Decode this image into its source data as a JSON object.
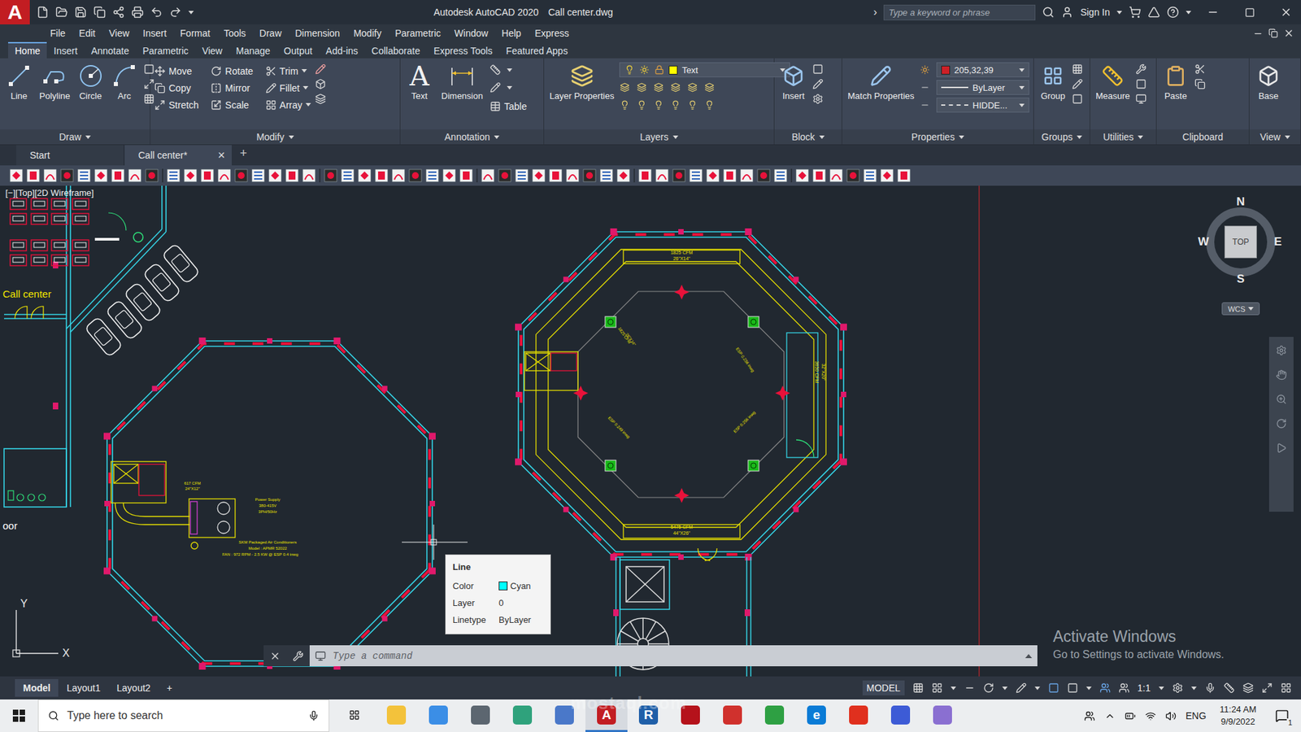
{
  "title_bar": {
    "logo": "A",
    "app": "Autodesk AutoCAD 2020",
    "file": "Call center.dwg",
    "expand": "›",
    "search_placeholder": "Type a keyword or phrase",
    "sign_in": "Sign In"
  },
  "menu": [
    "File",
    "Edit",
    "View",
    "Insert",
    "Format",
    "Tools",
    "Draw",
    "Dimension",
    "Modify",
    "Parametric",
    "Window",
    "Help",
    "Express"
  ],
  "ribbon_tabs": [
    {
      "label": "Home",
      "selected": true
    },
    {
      "label": "Insert",
      "selected": false
    },
    {
      "label": "Annotate",
      "selected": false
    },
    {
      "label": "Parametric",
      "selected": false
    },
    {
      "label": "View",
      "selected": false
    },
    {
      "label": "Manage",
      "selected": false
    },
    {
      "label": "Output",
      "selected": false
    },
    {
      "label": "Add-ins",
      "selected": false
    },
    {
      "label": "Collaborate",
      "selected": false
    },
    {
      "label": "Express Tools",
      "selected": false
    },
    {
      "label": "Featured Apps",
      "selected": false
    }
  ],
  "ribbon": {
    "draw": {
      "label": "Draw",
      "tools": [
        "Line",
        "Polyline",
        "Circle",
        "Arc"
      ]
    },
    "modify": {
      "label": "Modify",
      "tools": [
        {
          "label": "Move",
          "dropdown": false
        },
        {
          "label": "Rotate",
          "dropdown": false
        },
        {
          "label": "Trim",
          "dropdown": true
        },
        {
          "label": "Copy",
          "dropdown": false
        },
        {
          "label": "Mirror",
          "dropdown": false
        },
        {
          "label": "Fillet",
          "dropdown": true
        },
        {
          "label": "Stretch",
          "dropdown": false
        },
        {
          "label": "Scale",
          "dropdown": false
        },
        {
          "label": "Array",
          "dropdown": true
        }
      ]
    },
    "annotation": {
      "label": "Annotation",
      "text_glyph": "A",
      "text": "Text",
      "dimension": "Dimension",
      "table": "Table"
    },
    "layers": {
      "label": "Layers",
      "properties": "Layer Properties",
      "current_layer": "Text",
      "current_color": "#ffff00"
    },
    "block": {
      "label": "Block",
      "insert": "Insert"
    },
    "properties": {
      "label": "Properties",
      "match": "Match Properties",
      "color_value": "205,32,39",
      "color": "#cd2027",
      "lineweight": "ByLayer",
      "linetype": "HIDDE..."
    },
    "groups": {
      "label": "Groups",
      "group": "Group"
    },
    "utilities": {
      "label": "Utilities",
      "measure": "Measure"
    },
    "clipboard": {
      "label": "Clipboard",
      "paste": "Paste"
    },
    "view": {
      "label": "View",
      "base": "Base"
    }
  },
  "file_tabs": [
    {
      "label": "Start",
      "selected": false
    },
    {
      "label": "Call center*",
      "selected": true
    }
  ],
  "file_tab_close": "×",
  "file_tab_new": "+",
  "viewport_label": "[−][Top][2D Wireframe]",
  "drawing": {
    "annotations": [
      "Call center",
      "oor",
      "1825 CFM",
      "26\"X14\"",
      "5475 CFM",
      "44\"X26\"",
      "3650 CFM",
      "32\"X20\"",
      "617 CFM",
      "24\"X12\"",
      "Power Supply",
      "380-415V",
      "3PH/50Hz",
      "SKM Packaged Air Conditioners",
      "Model : APMR 52022",
      "FAN : 972 RPM - 2.5 KW @ ESP 0.4 inwg",
      "ESP 0.249 inwg",
      "ESP 0.256 inwg",
      "ESP 0.236 inwg",
      "1825 CFM",
      "26\"X14\""
    ]
  },
  "tooltip": {
    "title": "Line",
    "rows": [
      {
        "label": "Color",
        "value": "Cyan",
        "swatch": "#00ffff"
      },
      {
        "label": "Layer",
        "value": "0",
        "swatch": ""
      },
      {
        "label": "Linetype",
        "value": "ByLayer",
        "swatch": ""
      }
    ]
  },
  "viewcube": {
    "north": "N",
    "south": "S",
    "east": "E",
    "west": "W",
    "face": "TOP",
    "ucs": "WCS"
  },
  "ucs": {
    "x": "X",
    "y": "Y"
  },
  "command_line": {
    "placeholder": "Type a command"
  },
  "layout_tabs": [
    {
      "label": "Model",
      "selected": true
    },
    {
      "label": "Layout1",
      "selected": false
    },
    {
      "label": "Layout2",
      "selected": false
    }
  ],
  "layout_new": "+",
  "status_bar": {
    "space": "MODEL",
    "scale": "1:1"
  },
  "watermark": {
    "title": "Activate Windows",
    "subtitle": "Go to Settings to activate Windows.",
    "site": "mostaql.com"
  },
  "taskbar": {
    "search_placeholder": "Type here to search",
    "language": "ENG",
    "time": "11:24 AM",
    "date": "9/9/2022",
    "notifications": "1",
    "apps": [
      {
        "glyph": "",
        "color": "#f3c23b",
        "selected": false
      },
      {
        "glyph": "",
        "color": "#3b8ee6",
        "selected": false
      },
      {
        "glyph": "",
        "color": "#5c6670",
        "selected": false
      },
      {
        "glyph": "",
        "color": "#2fa27c",
        "selected": false
      },
      {
        "glyph": "",
        "color": "#4a78c9",
        "selected": false
      },
      {
        "glyph": "A",
        "color": "#c21d22",
        "selected": true
      },
      {
        "glyph": "R",
        "color": "#1f5fa8",
        "selected": false
      },
      {
        "glyph": "",
        "color": "#b5121b",
        "selected": false
      },
      {
        "glyph": "",
        "color": "#d0312d",
        "selected": false
      },
      {
        "glyph": "",
        "color": "#2ea043",
        "selected": false
      },
      {
        "glyph": "e",
        "color": "#0a7bd6",
        "selected": false
      },
      {
        "glyph": "",
        "color": "#e0301e",
        "selected": false
      },
      {
        "glyph": "",
        "color": "#3d5bd6",
        "selected": false
      },
      {
        "glyph": "",
        "color": "#8a6fd1",
        "selected": false
      }
    ]
  }
}
